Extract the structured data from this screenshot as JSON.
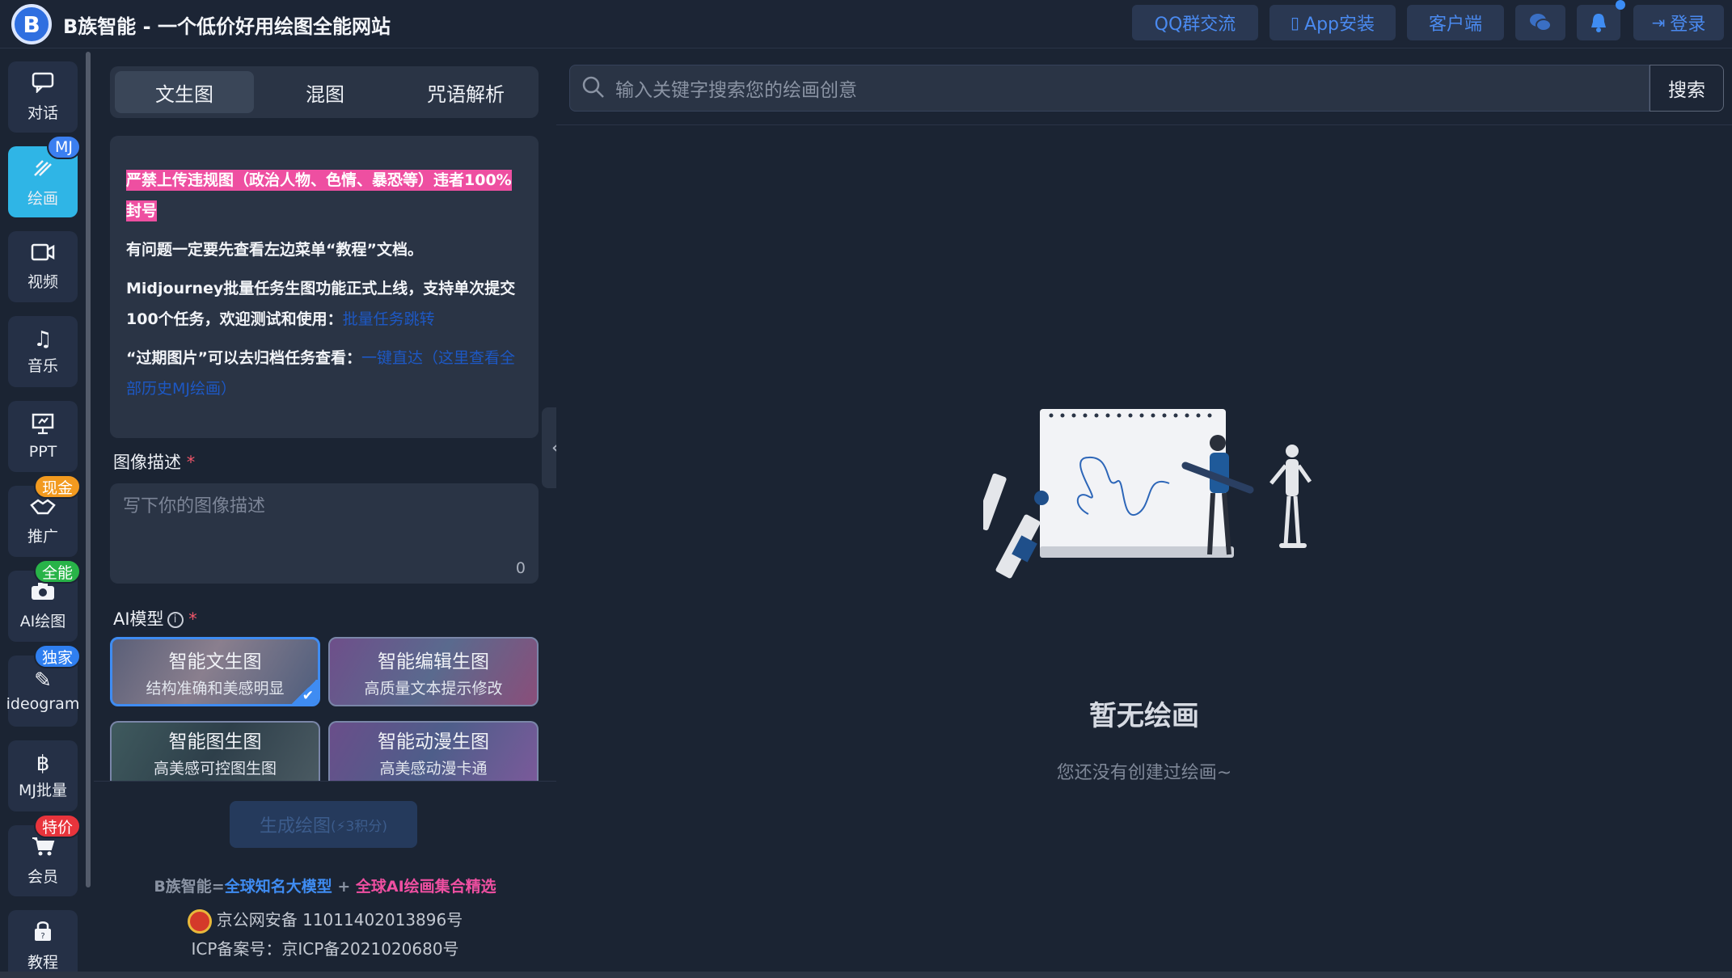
{
  "header": {
    "title": "B族智能 - 一个低价好用绘图全能网站",
    "logo_letter": "B",
    "buttons": {
      "qq": "QQ群交流",
      "app": "App安装",
      "client": "客户端",
      "login": "登录"
    }
  },
  "nav": {
    "items": [
      {
        "label": "对话",
        "icon": "chat-icon"
      },
      {
        "label": "绘画",
        "icon": "brush-icon",
        "badge": "MJ"
      },
      {
        "label": "视频",
        "icon": "video-icon"
      },
      {
        "label": "音乐",
        "icon": "music-icon"
      },
      {
        "label": "PPT",
        "icon": "presentation-icon"
      },
      {
        "label": "推广",
        "icon": "handshake-icon",
        "badge": "现金"
      },
      {
        "label": "AI绘图",
        "icon": "camera-icon",
        "badge": "全能"
      },
      {
        "label": "ideogram",
        "icon": "pen-icon",
        "badge": "独家"
      },
      {
        "label": "MJ批量",
        "icon": "bitcoin-icon"
      },
      {
        "label": "会员",
        "icon": "cart-icon",
        "badge": "特价"
      },
      {
        "label": "教程",
        "icon": "lock-icon"
      }
    ]
  },
  "panel": {
    "tabs": [
      "文生图",
      "混图",
      "咒语解析"
    ],
    "notice": {
      "warning": "严禁上传违规图（政治人物、色情、暴恐等）违者100%封号",
      "line1": "有问题一定要先查看左边菜单“教程”文档。",
      "line2": "Midjourney批量任务生图功能正式上线，支持单次提交100个任务，欢迎测试和使用：",
      "line2_link": "批量任务跳转",
      "line3": "“过期图片”可以去归档任务查看：",
      "line3_link": "一键直达",
      "line3_link2": "（这里查看全部历史MJ绘画）"
    },
    "description_label": "图像描述",
    "required_mark": "*",
    "description_placeholder": "写下你的图像描述",
    "char_count": "0",
    "model_label": "AI模型",
    "info_glyph": "i",
    "models": [
      {
        "title": "智能文生图",
        "sub": "结构准确和美感明显"
      },
      {
        "title": "智能编辑生图",
        "sub": "高质量文本提示修改"
      },
      {
        "title": "智能图生图",
        "sub": "高美感可控图生图"
      },
      {
        "title": "智能动漫生图",
        "sub": "高美感动漫卡通"
      }
    ],
    "generate": {
      "label": "生成绘图",
      "cost": "(⚡3积分)"
    },
    "footer": {
      "brand": "B族智能=",
      "part1": "全球知名大模型",
      "plus": " + ",
      "part2": "全球AI绘画集合精选",
      "police": "京公网安备 11011402013896号",
      "icp": "ICP备案号：京ICP备2021020680号"
    }
  },
  "main": {
    "search_placeholder": "输入关键字搜索您的绘画创意",
    "search_button": "搜索",
    "empty_title": "暂无绘画",
    "empty_sub": "您还没有创建过绘画~"
  },
  "colors": {
    "accent": "#2fb5e6",
    "link_blue": "#3f8cf2",
    "warning_pink": "#ee4fa1"
  }
}
